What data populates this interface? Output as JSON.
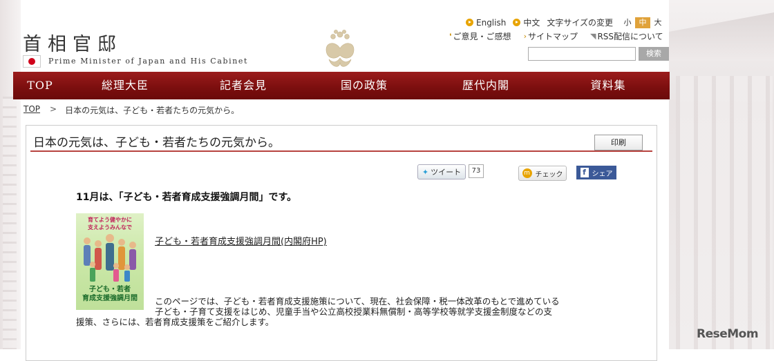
{
  "header": {
    "title": "首相官邸",
    "subtitle": "Prime Minister of Japan and His Cabinet",
    "lang": {
      "english": "English",
      "chinese": "中文"
    },
    "font_size_label": "文字サイズの変更",
    "font_sizes": [
      "小",
      "中",
      "大"
    ],
    "links": [
      "ご意見・ご感想",
      "サイトマップ",
      "RSS配信について"
    ],
    "search_button": "検索",
    "search_value": ""
  },
  "nav": [
    "TOP",
    "総理大臣",
    "記者会見",
    "国の政策",
    "歴代内閣",
    "資料集"
  ],
  "breadcrumb": {
    "top": "TOP",
    "separator": ">",
    "current": "日本の元気は、子ども・若者たちの元気から。"
  },
  "page": {
    "title": "日本の元気は、子ども・若者たちの元気から。",
    "print_button": "印刷",
    "tweet_label": "ツイート",
    "tweet_count": "73",
    "check_label": "チェック",
    "share_label": "シェア",
    "heading": "11月は、「子ども・若者育成支援強調月間」です。",
    "poster_top": [
      "育てよう健やかに",
      "支えようみんなで"
    ],
    "poster_bottom": [
      "子ども・若者",
      "育成支援強調月間"
    ],
    "link": "子ども・若者育成支援強調月間(内閣府HP)",
    "description_1": "このページでは、子ども・若者育成支援施策について、現在、社会保障・税一体改革のもとで進めている",
    "description_2": "子ども・子育て支援をはじめ、児童手当や公立高校授業料無償制・高等学校等就学支援金制度などの支",
    "description_3": "援策、さらには、若者育成支援策をご紹介します。"
  },
  "watermark": "ReseMom",
  "colors": {
    "nav": "#7d0f0f",
    "accent": "#e8a400",
    "facebook": "#3b5998"
  }
}
